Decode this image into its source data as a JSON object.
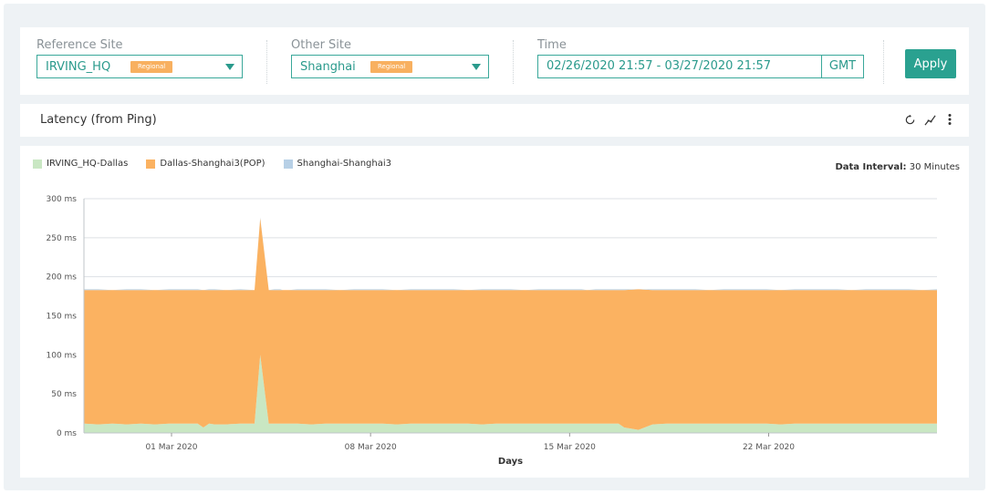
{
  "filters": {
    "reference_site": {
      "label": "Reference Site",
      "value": "IRVING_HQ",
      "badge": "Regional"
    },
    "other_site": {
      "label": "Other Site",
      "value": "Shanghai",
      "badge": "Regional"
    },
    "time": {
      "label": "Time",
      "range": "02/26/2020 21:57 - 03/27/2020 21:57",
      "zone": "GMT"
    },
    "apply_label": "Apply"
  },
  "panel": {
    "title": "Latency (from Ping)"
  },
  "icons": [
    "refresh-icon",
    "line-chart-toggle-icon",
    "more-vertical-icon"
  ],
  "data_interval": {
    "label": "Data Interval:",
    "value": "30 Minutes"
  },
  "colors": {
    "accent": "#2aa190",
    "badge": "#f8b060",
    "series_green": "#c9e7c3",
    "series_orange": "#fbb261",
    "series_blue": "#b7d0e6"
  },
  "chart_data": {
    "type": "area",
    "stacked": true,
    "xlabel": "Days",
    "ylabel": "",
    "ylim": [
      0,
      300
    ],
    "yticks": [
      "0 ms",
      "50 ms",
      "100 ms",
      "150 ms",
      "200 ms",
      "250 ms",
      "300 ms"
    ],
    "ytick_values": [
      0,
      50,
      100,
      150,
      200,
      250,
      300
    ],
    "xticks": [
      "01 Mar 2020",
      "08 Mar 2020",
      "15 Mar 2020",
      "22 Mar 2020"
    ],
    "xtick_days": [
      3.08,
      10.08,
      17.08,
      24.08
    ],
    "x_range_days": [
      0,
      30
    ],
    "x": [
      0,
      0.5,
      1,
      1.5,
      2,
      2.5,
      3,
      3.5,
      4,
      4.2,
      4.4,
      4.6,
      5,
      5.5,
      6,
      6.2,
      6.5,
      6.7,
      6.9,
      7,
      7.2,
      7.5,
      8,
      8.5,
      9,
      9.5,
      10,
      10.5,
      11,
      11.5,
      12,
      12.5,
      13,
      13.5,
      14,
      14.5,
      15,
      15.5,
      16,
      16.5,
      17,
      17.5,
      17.7,
      18,
      18.5,
      18.8,
      19,
      19.5,
      20,
      20.5,
      21,
      21.5,
      22,
      22.5,
      23,
      23.5,
      24,
      24.5,
      25,
      25.5,
      26,
      26.5,
      27,
      27.5,
      28,
      28.5,
      29,
      29.5,
      30
    ],
    "series": [
      {
        "name": "IRVING_HQ-Dallas",
        "color": "#c9e7c3",
        "values": [
          12,
          11,
          12,
          11,
          12,
          11,
          12,
          12,
          12,
          7,
          12,
          11,
          11,
          12,
          12,
          100,
          12,
          12,
          12,
          12,
          12,
          12,
          11,
          12,
          12,
          12,
          12,
          12,
          11,
          12,
          12,
          12,
          12,
          12,
          11,
          12,
          12,
          12,
          12,
          12,
          12,
          12,
          12,
          12,
          12,
          12,
          7,
          4,
          11,
          12,
          12,
          12,
          12,
          12,
          12,
          12,
          12,
          11,
          12,
          12,
          12,
          12,
          12,
          12,
          12,
          12,
          12,
          12,
          12
        ]
      },
      {
        "name": "Dallas-Shanghai3(POP)",
        "color": "#fbb261",
        "values": [
          171,
          172,
          171,
          172,
          171,
          172,
          171,
          171,
          171,
          176,
          171,
          172,
          172,
          171,
          171,
          175,
          171,
          171,
          171,
          171,
          171,
          171,
          172,
          171,
          171,
          171,
          171,
          171,
          172,
          171,
          171,
          171,
          171,
          171,
          172,
          171,
          171,
          171,
          171,
          171,
          171,
          171,
          171,
          171,
          171,
          171,
          176,
          180,
          172,
          171,
          171,
          171,
          171,
          171,
          171,
          171,
          171,
          172,
          171,
          171,
          171,
          171,
          171,
          171,
          171,
          171,
          171,
          171,
          171
        ]
      },
      {
        "name": "Shanghai-Shanghai3",
        "color": "#b7d0e6",
        "values": [
          1,
          1,
          0,
          1,
          1,
          0,
          1,
          1,
          1,
          0,
          1,
          1,
          0,
          1,
          0,
          1,
          0,
          1,
          1,
          0,
          0,
          1,
          1,
          1,
          0,
          1,
          1,
          1,
          0,
          1,
          1,
          1,
          1,
          0,
          1,
          1,
          1,
          0,
          1,
          1,
          1,
          1,
          0,
          1,
          1,
          1,
          1,
          0,
          1,
          1,
          1,
          1,
          0,
          1,
          1,
          1,
          1,
          0,
          1,
          1,
          1,
          1,
          0,
          1,
          1,
          1,
          1,
          0,
          1
        ]
      }
    ]
  }
}
